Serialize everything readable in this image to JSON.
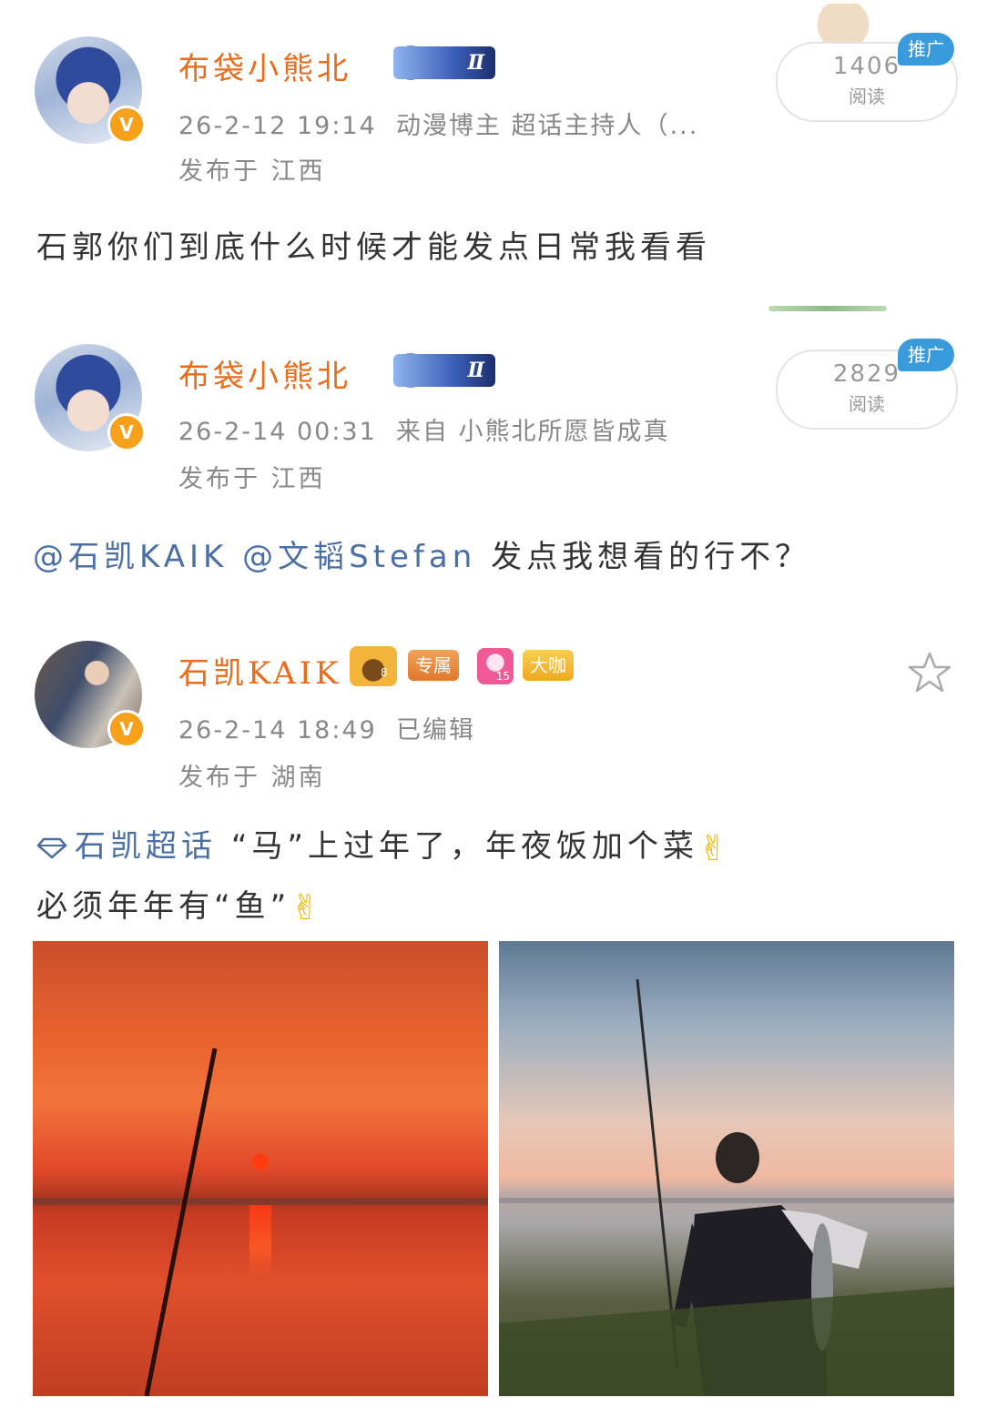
{
  "posts": [
    {
      "user": {
        "name": "布袋小熊北",
        "level_badge": "Ⅱ"
      },
      "timestamp": "26-2-12 19:14",
      "source": "动漫博主 超话主持人（...",
      "location": "发布于 江西",
      "read_count": "1406",
      "read_label": "阅读",
      "promo_label": "推广",
      "content": "石郭你们到底什么时候才能发点日常我看看"
    },
    {
      "user": {
        "name": "布袋小熊北",
        "level_badge": "Ⅱ"
      },
      "timestamp": "26-2-14 00:31",
      "source": "来自 小熊北所愿皆成真",
      "location": "发布于 江西",
      "read_count": "2829",
      "read_label": "阅读",
      "promo_label": "推广",
      "content": {
        "mention1": "@石凯KAIK",
        "mention2": "@文韬Stefan",
        "text": " 发点我想看的行不？"
      }
    },
    {
      "user": {
        "name": "石凯KAIK",
        "crown_level": "8",
        "tag_exclusive": "专属",
        "gem_level": "15",
        "tag_bigshot": "大咖"
      },
      "timestamp": "26-2-14 18:49",
      "source": "已编辑",
      "location": "发布于 湖南",
      "content": {
        "topic": "石凯超话",
        "line1": " “马”上过年了，年夜饭加个菜",
        "line2": "必须年年有“鱼”",
        "emoji": "✌"
      }
    }
  ],
  "colors": {
    "username": "#e86c1c",
    "mention": "#4a6fa5",
    "promo": "#3a9bdc",
    "vip_badge": "#f7a11a"
  },
  "icons": [
    "verified-v-icon",
    "bear-level-icon",
    "crown-icon",
    "gem-icon",
    "star-icon",
    "diamond-topic-icon",
    "victory-hand-emoji"
  ]
}
